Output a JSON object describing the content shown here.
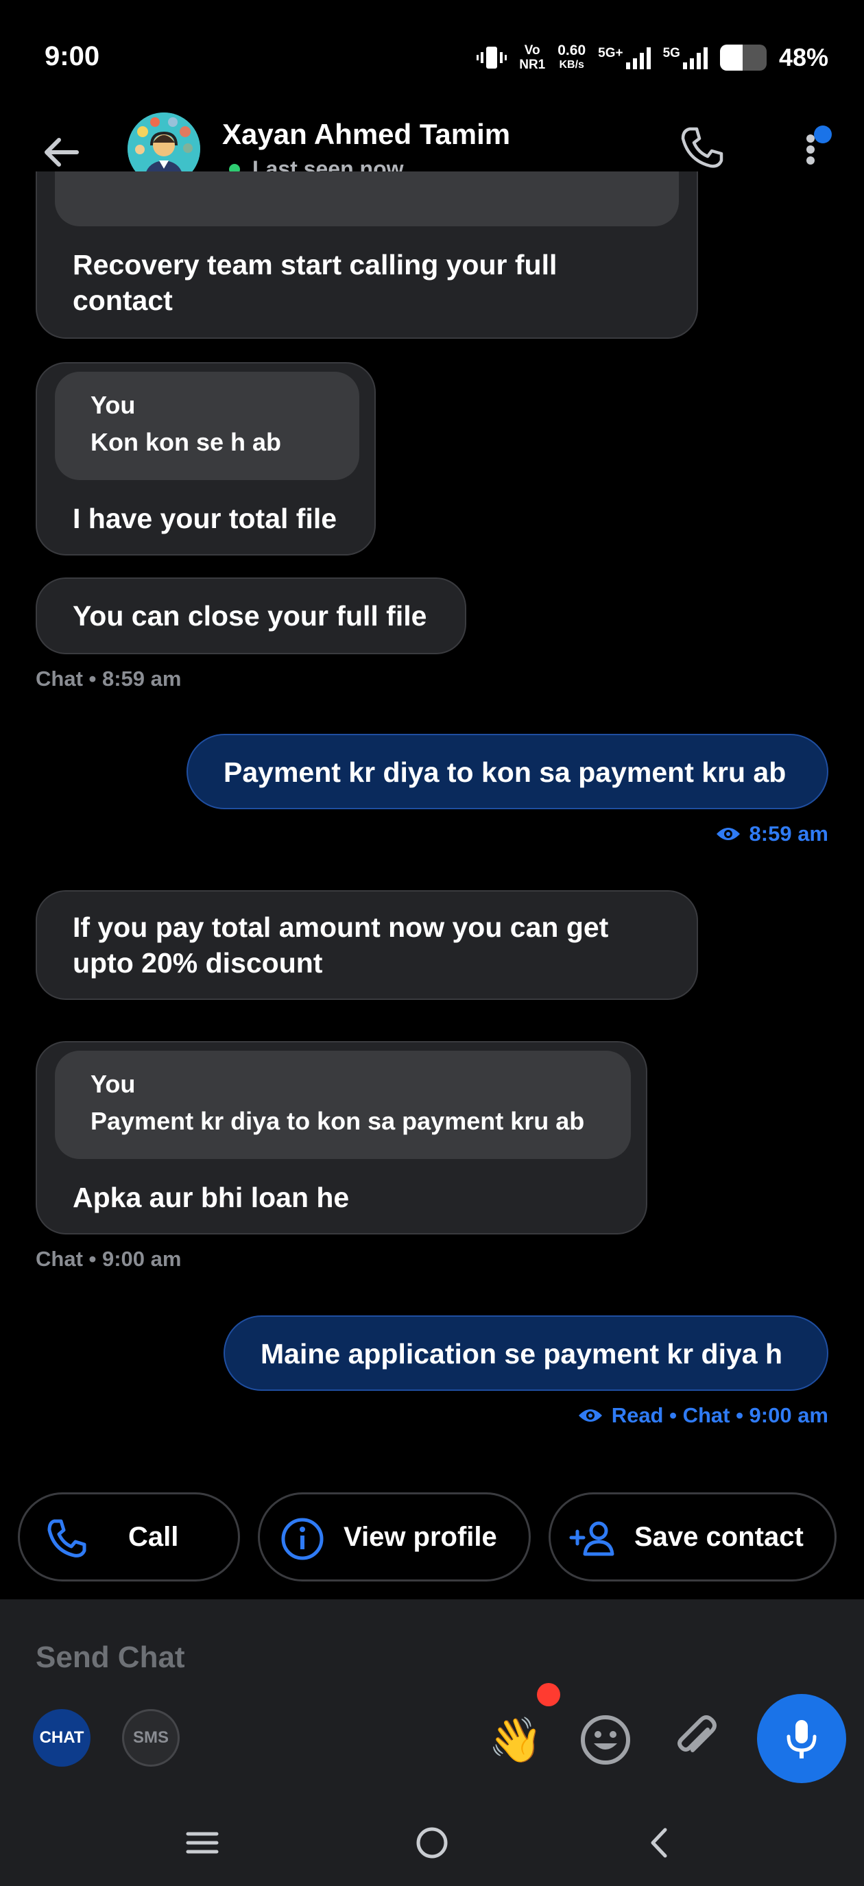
{
  "status_bar": {
    "time": "9:00",
    "volte_top": "Vo",
    "volte_bottom": "NR1",
    "net_speed_value": "0.60",
    "net_speed_unit": "KB/s",
    "network_1": "5G+",
    "network_2": "5G",
    "battery_percent": "48%",
    "battery_level": 0.48
  },
  "header": {
    "contact_name": "Xayan Ahmed Tamim",
    "presence": "Last seen now",
    "presence_color": "#2ecc71"
  },
  "messages": [
    {
      "direction": "incoming",
      "text_line1": "Recovery team start calling your full",
      "text_line2": "contact"
    },
    {
      "direction": "incoming",
      "quote_author": "You",
      "quote_text": "Kon kon se h ab",
      "text": "I have your total file"
    },
    {
      "direction": "incoming",
      "text": "You can close your full file"
    },
    {
      "meta": "Chat • 8:59 am"
    },
    {
      "direction": "outgoing",
      "text": "Payment kr diya to kon sa payment kru ab",
      "meta": "8:59 am"
    },
    {
      "direction": "incoming",
      "text_line1": "If you pay total amount now you can get",
      "text_line2": "upto 20% discount"
    },
    {
      "direction": "incoming",
      "quote_author": "You",
      "quote_text": "Payment kr diya to kon sa payment kru ab",
      "text": "Apka aur bhi loan he"
    },
    {
      "meta": "Chat • 9:00 am"
    },
    {
      "direction": "outgoing",
      "text": "Maine application se payment kr diya h",
      "meta": "Read • Chat • 9:00 am"
    }
  ],
  "actions": {
    "call": "Call",
    "view_profile": "View profile",
    "save_contact": "Save contact"
  },
  "composer": {
    "placeholder": "Send Chat",
    "mode_chat": "CHAT",
    "mode_sms": "SMS",
    "wave_emoji": "👋"
  },
  "colors": {
    "accent": "#1a73e8",
    "outgoing_bubble": "#0a2a5c",
    "incoming_bubble": "#232427",
    "read_receipt": "#2f7bf5"
  }
}
